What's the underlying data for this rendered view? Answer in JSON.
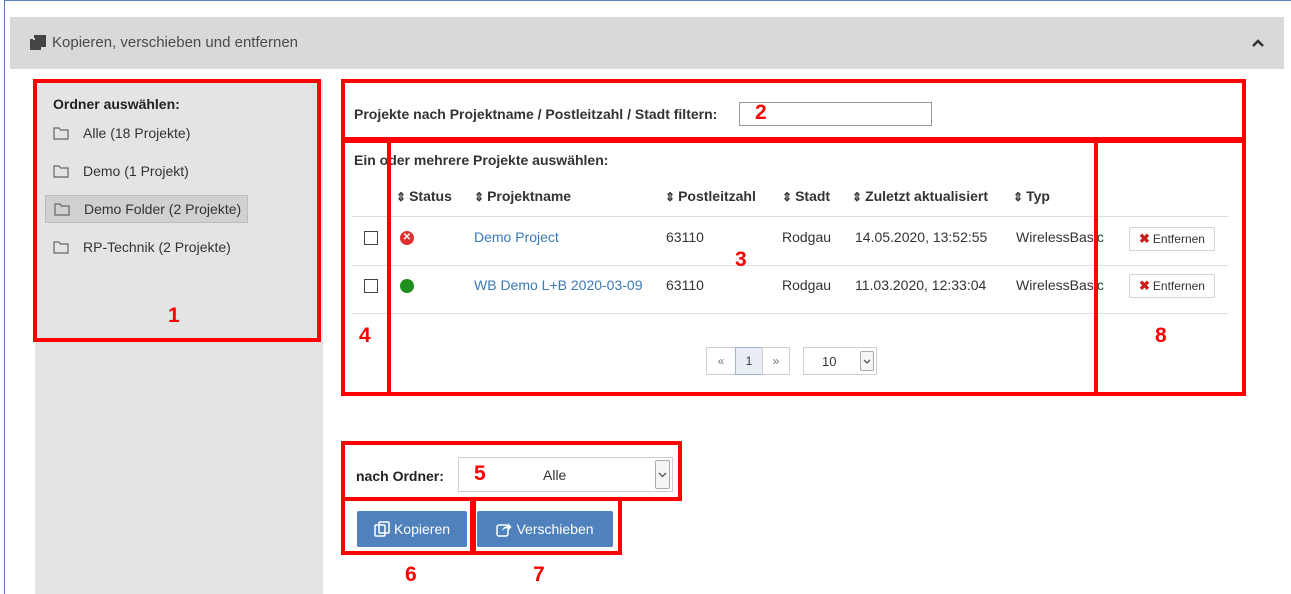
{
  "header": {
    "title": "Kopieren, verschieben und entfernen"
  },
  "sidebar": {
    "title": "Ordner auswählen:",
    "items": [
      {
        "label": "Alle (18 Projekte)"
      },
      {
        "label": "Demo (1 Projekt)"
      },
      {
        "label": "Demo Folder (2 Projekte)",
        "selected": true
      },
      {
        "label": "RP-Technik (2 Projekte)"
      }
    ]
  },
  "filter": {
    "label": "Projekte nach Projektname / Postleitzahl / Stadt filtern:",
    "value": ""
  },
  "table": {
    "hint": "Ein oder mehrere Projekte auswählen:",
    "columns": [
      "Status",
      "Projektname",
      "Postleitzahl",
      "Stadt",
      "Zuletzt aktualisiert",
      "Typ"
    ],
    "rows": [
      {
        "status": "error",
        "name": "Demo Project",
        "plz": "63110",
        "city": "Rodgau",
        "updated": "14.05.2020, 13:52:55",
        "type": "WirelessBasic",
        "remove": "Entfernen"
      },
      {
        "status": "ok",
        "name": "WB Demo L+B 2020-03-09",
        "plz": "63110",
        "city": "Rodgau",
        "updated": "11.03.2020, 12:33:04",
        "type": "WirelessBasic",
        "remove": "Entfernen"
      }
    ]
  },
  "pagination": {
    "prev": "«",
    "current": "1",
    "next": "»",
    "page_size": "10"
  },
  "target": {
    "label": "nach Ordner:",
    "value": "Alle"
  },
  "actions": {
    "copy": "Kopieren",
    "move": "Verschieben"
  },
  "annotations": [
    "1",
    "2",
    "3",
    "4",
    "5",
    "6",
    "7",
    "8"
  ],
  "colors": {
    "annotation": "#ff0000",
    "button": "#4f81bd",
    "link": "#3a79b8",
    "status_error": "#e03030",
    "status_ok": "#1e8f1e"
  }
}
